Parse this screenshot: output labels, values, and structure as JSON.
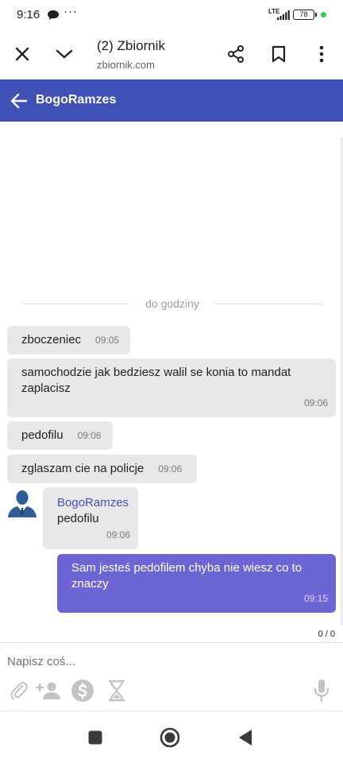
{
  "status_bar": {
    "time": "9:16",
    "dots": "···",
    "network": "LTE",
    "battery": "78"
  },
  "browser": {
    "title": "(2) Zbiornik",
    "url": "zbiornik.com",
    "icons": [
      "close-icon",
      "chevron-down-icon",
      "share-icon",
      "bookmark-icon",
      "more-vert-icon"
    ]
  },
  "chat": {
    "header_title": "BogoRamzes",
    "divider_label": "do godziny",
    "messages": [
      {
        "text": "zboczeniec",
        "time": "09:05"
      },
      {
        "text": "samochodzie jak bedziesz walil se konia to mandat zaplacisz",
        "time": "09:06"
      },
      {
        "text": "pedofilu",
        "time": "09:06"
      },
      {
        "text": "zglaszam cie na policje",
        "time": "09:06"
      },
      {
        "sender": "BogoRamzes",
        "text": "pedofilu",
        "time": "09:06"
      },
      {
        "text": "Sam jesteś pedofilem chyba nie wiesz co to znaczy",
        "time": "09:15"
      }
    ],
    "counter": "0 / 0"
  },
  "composer": {
    "placeholder": "Napisz coś...",
    "icons": [
      "paperclip-icon",
      "add-person-icon",
      "dollar-coin-icon",
      "hourglass-icon",
      "microphone-icon"
    ]
  },
  "colors": {
    "header": "#3f51b5",
    "outgoing_bubble": "#6b66d4",
    "incoming_bubble": "#e8e8e8"
  }
}
